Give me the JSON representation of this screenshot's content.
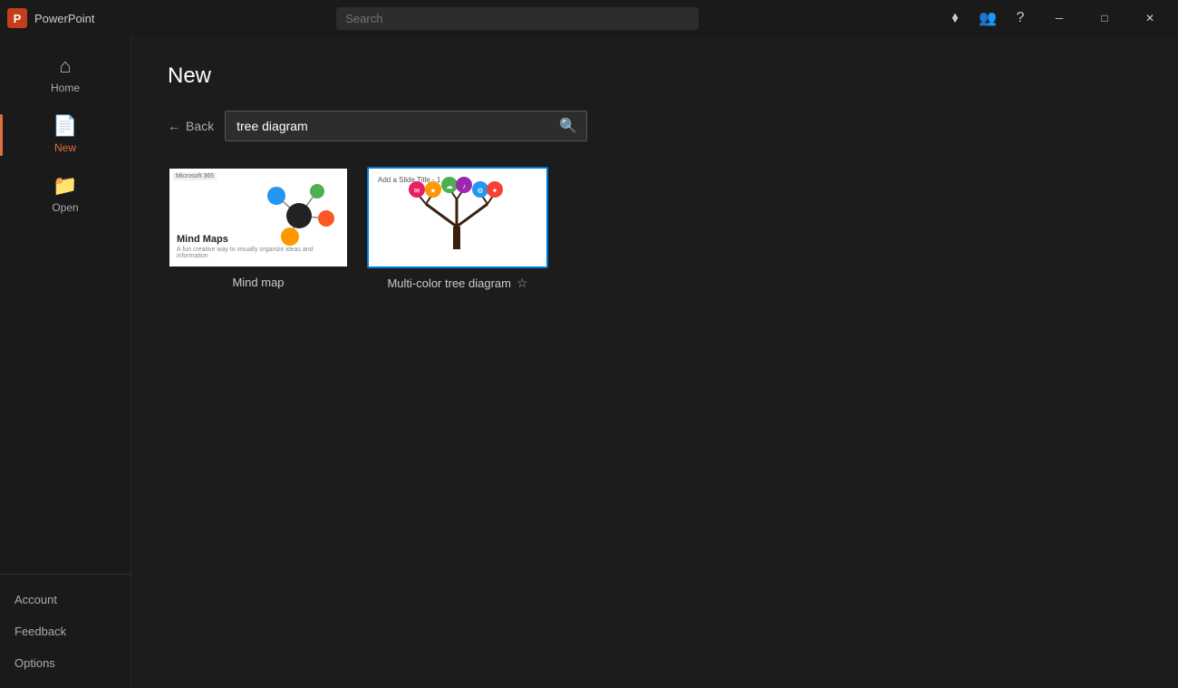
{
  "titlebar": {
    "app_name": "PowerPoint",
    "app_icon": "P",
    "search_placeholder": "Search",
    "icons": [
      "diamond",
      "people",
      "question",
      "minimize",
      "maximize",
      "close"
    ]
  },
  "sidebar": {
    "items": [
      {
        "id": "home",
        "label": "Home",
        "active": false
      },
      {
        "id": "new",
        "label": "New",
        "active": true
      },
      {
        "id": "open",
        "label": "Open",
        "active": false
      }
    ],
    "bottom_items": [
      {
        "id": "account",
        "label": "Account"
      },
      {
        "id": "feedback",
        "label": "Feedback"
      },
      {
        "id": "options",
        "label": "Options"
      }
    ]
  },
  "content": {
    "page_title": "New",
    "back_label": "Back",
    "search_value": "tree diagram",
    "templates": [
      {
        "id": "mind-map",
        "label": "Mind map",
        "selected": false,
        "badge": "Microsoft 365",
        "title": "Mind Maps",
        "subtitle": "A fun creative way to visually organize ideas and information"
      },
      {
        "id": "tree-diagram",
        "label": "Multi-color tree diagram",
        "selected": true,
        "slide_title": "Add a Slide Title - 1"
      }
    ]
  }
}
